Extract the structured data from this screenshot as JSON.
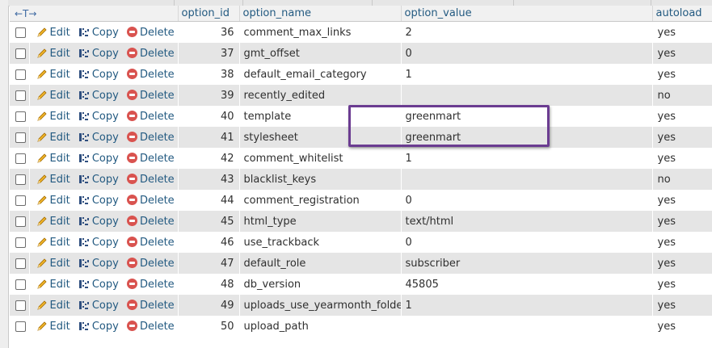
{
  "header": {
    "arrows": "←T→",
    "col_option_id": "option_id",
    "col_option_name": "option_name",
    "col_option_value": "option_value",
    "col_autoload": "autoload"
  },
  "actions": {
    "edit": "Edit",
    "copy": "Copy",
    "delete": "Delete"
  },
  "rows": [
    {
      "id": "36",
      "name": "comment_max_links",
      "value": "2",
      "autoload": "yes"
    },
    {
      "id": "37",
      "name": "gmt_offset",
      "value": "0",
      "autoload": "yes"
    },
    {
      "id": "38",
      "name": "default_email_category",
      "value": "1",
      "autoload": "yes"
    },
    {
      "id": "39",
      "name": "recently_edited",
      "value": "",
      "autoload": "no"
    },
    {
      "id": "40",
      "name": "template",
      "value": "greenmart",
      "autoload": "yes"
    },
    {
      "id": "41",
      "name": "stylesheet",
      "value": "greenmart",
      "autoload": "yes"
    },
    {
      "id": "42",
      "name": "comment_whitelist",
      "value": "1",
      "autoload": "yes"
    },
    {
      "id": "43",
      "name": "blacklist_keys",
      "value": "",
      "autoload": "no"
    },
    {
      "id": "44",
      "name": "comment_registration",
      "value": "0",
      "autoload": "yes"
    },
    {
      "id": "45",
      "name": "html_type",
      "value": "text/html",
      "autoload": "yes"
    },
    {
      "id": "46",
      "name": "use_trackback",
      "value": "0",
      "autoload": "yes"
    },
    {
      "id": "47",
      "name": "default_role",
      "value": "subscriber",
      "autoload": "yes"
    },
    {
      "id": "48",
      "name": "db_version",
      "value": "45805",
      "autoload": "yes"
    },
    {
      "id": "49",
      "name": "uploads_use_yearmonth_folders",
      "value": "1",
      "autoload": "yes"
    },
    {
      "id": "50",
      "name": "upload_path",
      "value": "",
      "autoload": "yes"
    }
  ],
  "colors": {
    "link": "#235a81",
    "row_alt": "#e5e5e5",
    "highlight": "#6b3c91",
    "delete_icon": "#d9534f"
  }
}
